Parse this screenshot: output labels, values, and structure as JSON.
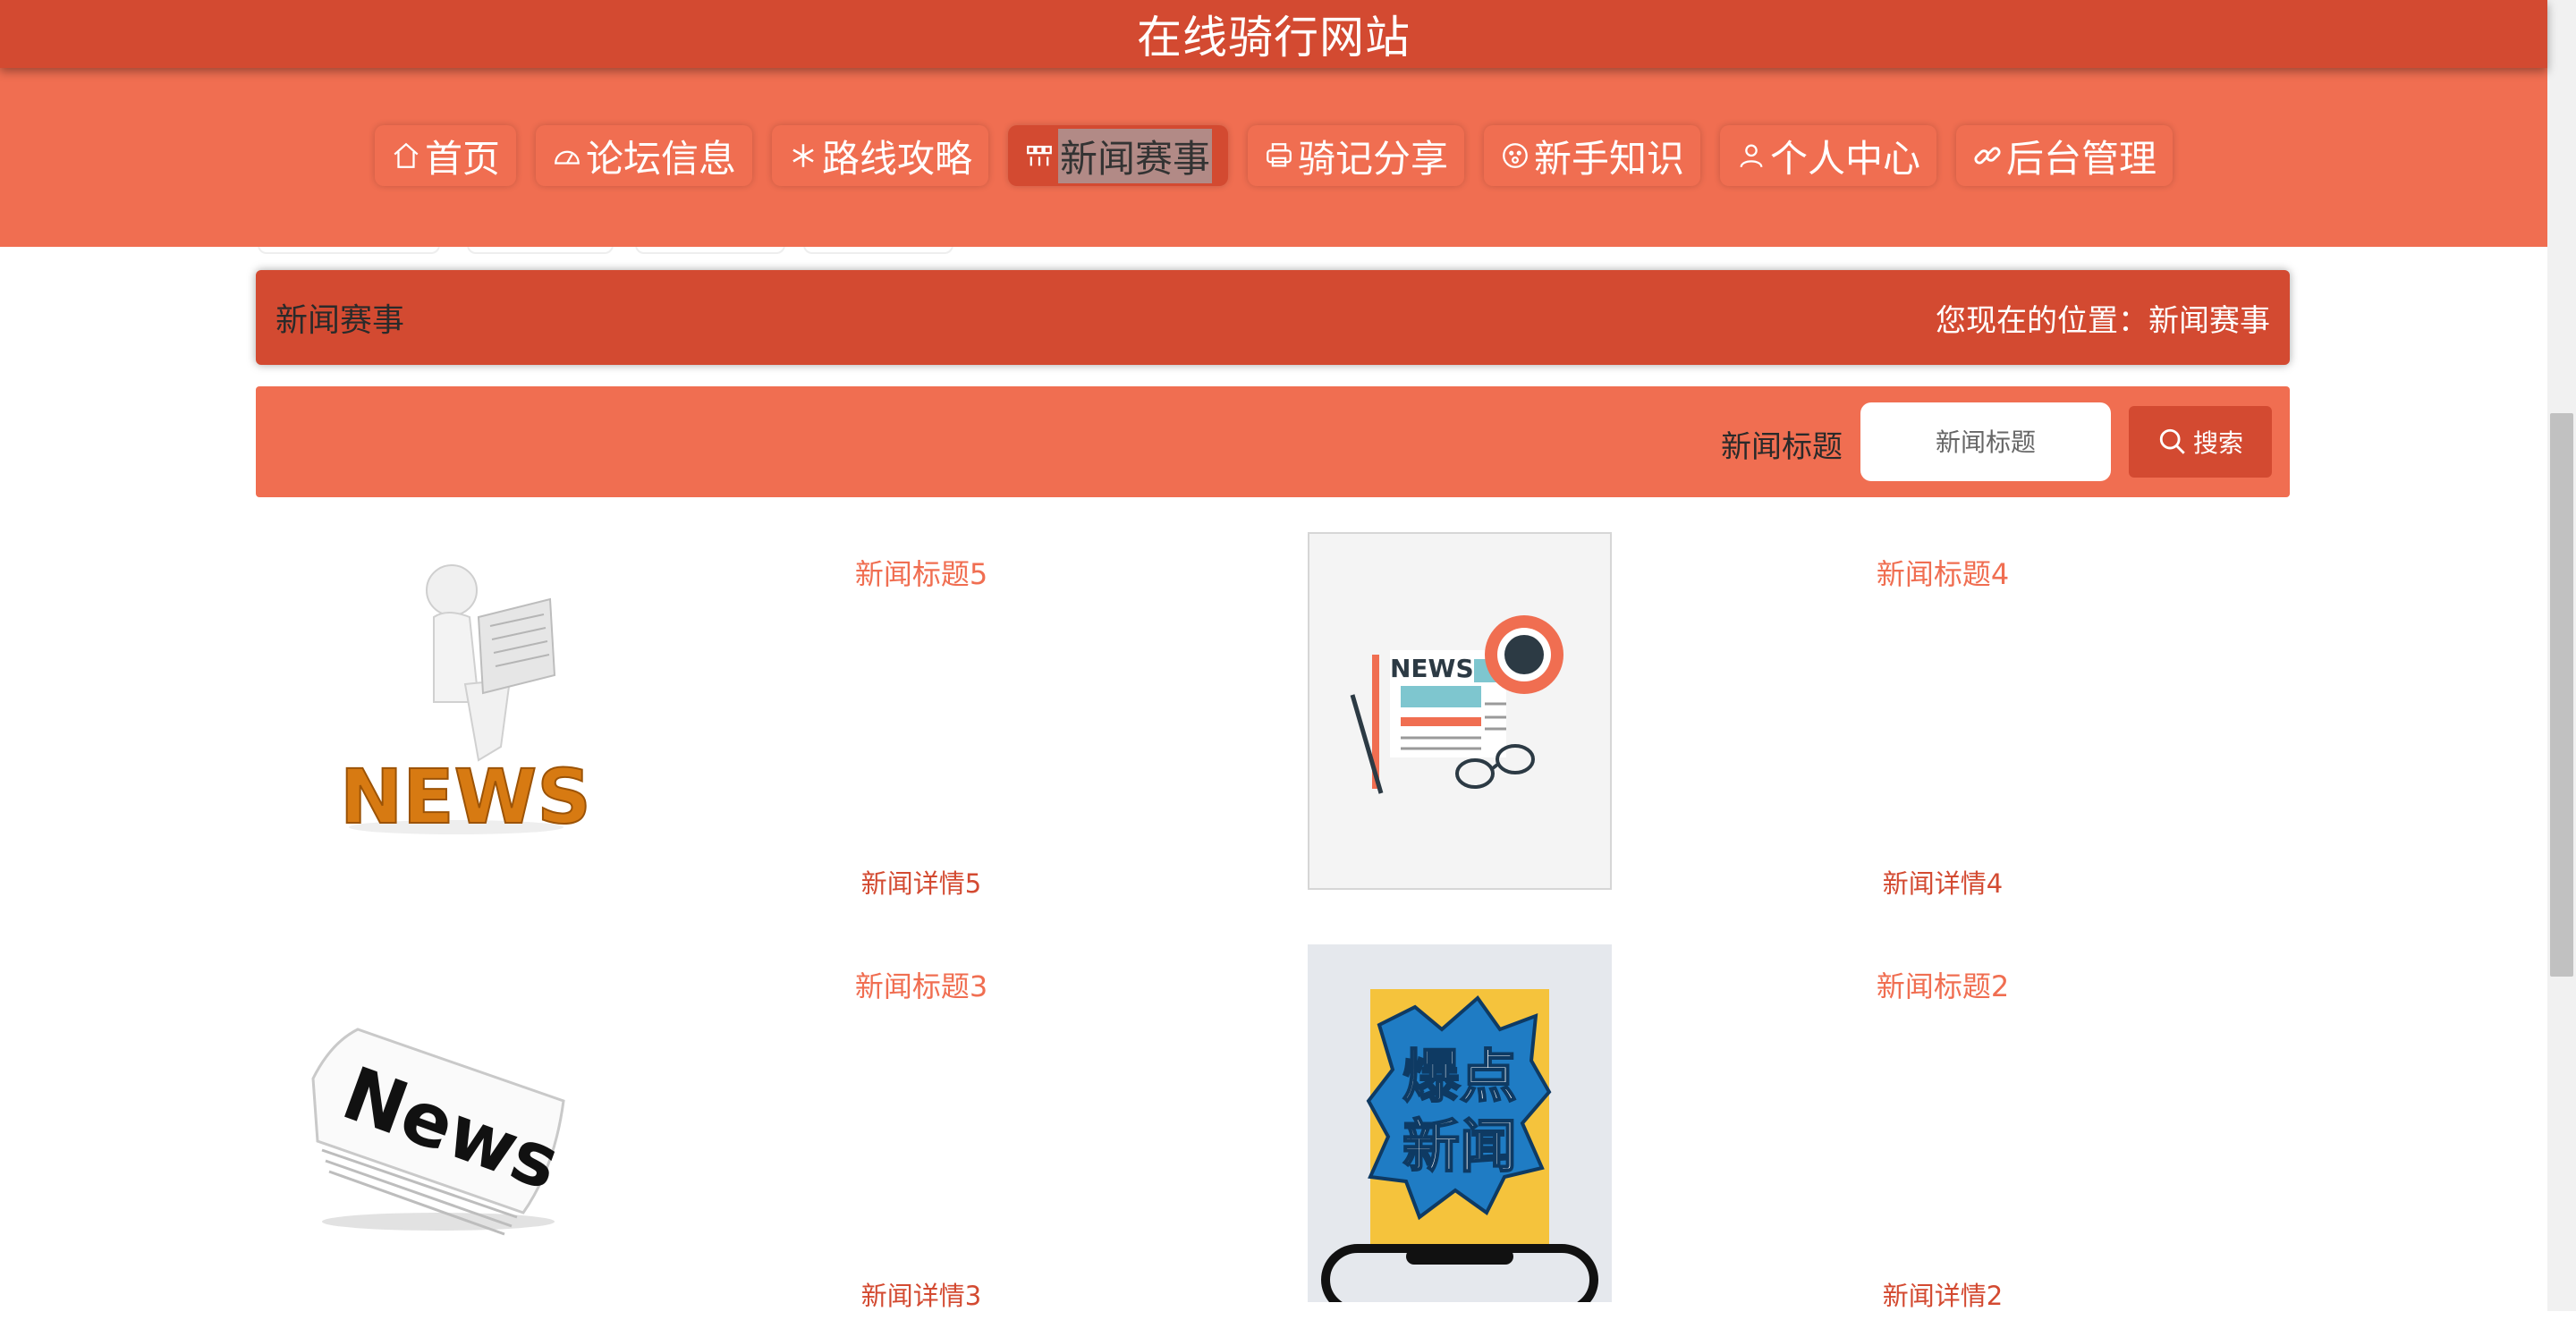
{
  "header": {
    "site_title": "在线骑行网站"
  },
  "nav": {
    "items": [
      {
        "label": "首页",
        "icon": "home-icon"
      },
      {
        "label": "论坛信息",
        "icon": "dashboard-icon"
      },
      {
        "label": "路线攻略",
        "icon": "snowflake-icon"
      },
      {
        "label": "新闻赛事",
        "icon": "grid-icon",
        "active": true
      },
      {
        "label": "骑记分享",
        "icon": "printer-icon"
      },
      {
        "label": "新手知识",
        "icon": "smile-icon"
      },
      {
        "label": "个人中心",
        "icon": "user-icon"
      },
      {
        "label": "后台管理",
        "icon": "link-icon"
      }
    ]
  },
  "breadcrumb": {
    "title": "新闻赛事",
    "location": "您现在的位置：新闻赛事"
  },
  "search": {
    "label": "新闻标题",
    "placeholder": "新闻标题",
    "button_label": "搜索"
  },
  "news": [
    {
      "title": "新闻标题5",
      "detail": "新闻详情5",
      "thumb_word": "NEWS"
    },
    {
      "title": "新闻标题4",
      "detail": "新闻详情4",
      "thumb_word": "NEWS"
    },
    {
      "title": "新闻标题3",
      "detail": "新闻详情3",
      "thumb_word": "News"
    },
    {
      "title": "新闻标题2",
      "detail": "新闻详情2",
      "thumb_word": "爆点新闻"
    }
  ],
  "colors": {
    "primary": "#d34a31",
    "secondary": "#f06e51",
    "text_dark": "#2a2a2a",
    "active_label_bg": "#b28a86"
  }
}
